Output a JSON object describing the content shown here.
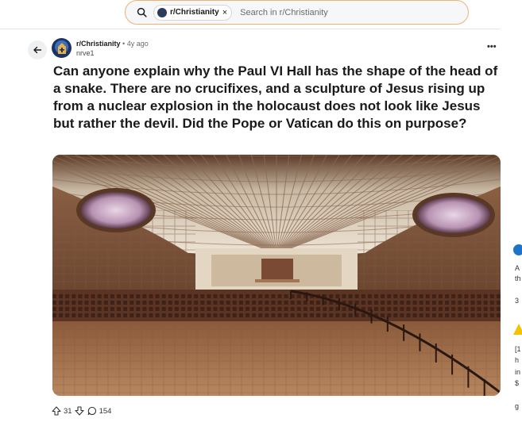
{
  "search": {
    "chip_label": "r/Christianity",
    "chip_close": "×",
    "placeholder": "Search in r/Christianity"
  },
  "post": {
    "subreddit": "r/Christianity",
    "separator": "•",
    "age": "4y ago",
    "author": "nrve1",
    "more": "•••",
    "title": "Can anyone explain why the Paul VI Hall has the shape of the head of a snake. There are no crucifixes, and a sculpture of Jesus rising up from a nuclear explosion in the holocaust does not look like Jesus but rather the devil. Did the Pope or Vatican do this on purpose?",
    "upvotes": "31",
    "comments": "154"
  },
  "side_fragments": [
    "A",
    "th",
    "3",
    "[1",
    "h",
    "in",
    "$",
    "g"
  ],
  "colors": {
    "search_border": "#f0b070",
    "accent_blue": "#1d73c9"
  }
}
